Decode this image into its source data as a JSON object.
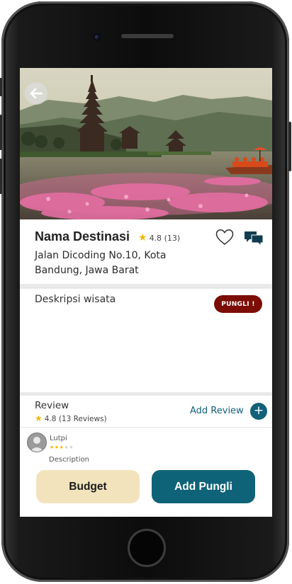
{
  "destination": {
    "title": "Nama Destinasi",
    "rating": "4.8",
    "rating_count": "(13)",
    "address": "Jalan Dicoding No.10, Kota Bandung, Jawa Barat"
  },
  "description": {
    "title": "Deskripsi wisata",
    "badge": "PUNGLI !"
  },
  "review": {
    "title": "Review",
    "rating": "4.8",
    "count": "(13 Reviews)",
    "add_label": "Add Review",
    "items": [
      {
        "name": "Lutpi",
        "stars": 3,
        "max_stars": 5,
        "text": "Description"
      }
    ]
  },
  "actions": {
    "budget_label": "Budget",
    "pungli_label": "Add Pungli"
  },
  "icons": {
    "back": "arrow-left-icon",
    "favorite": "heart-icon",
    "chat": "chat-bubbles-icon",
    "add": "plus-icon",
    "star": "star-icon"
  },
  "colors": {
    "primary": "#0f6379",
    "badge": "#7b0d05",
    "budget": "#f3e3bd",
    "star": "#f2b705"
  }
}
